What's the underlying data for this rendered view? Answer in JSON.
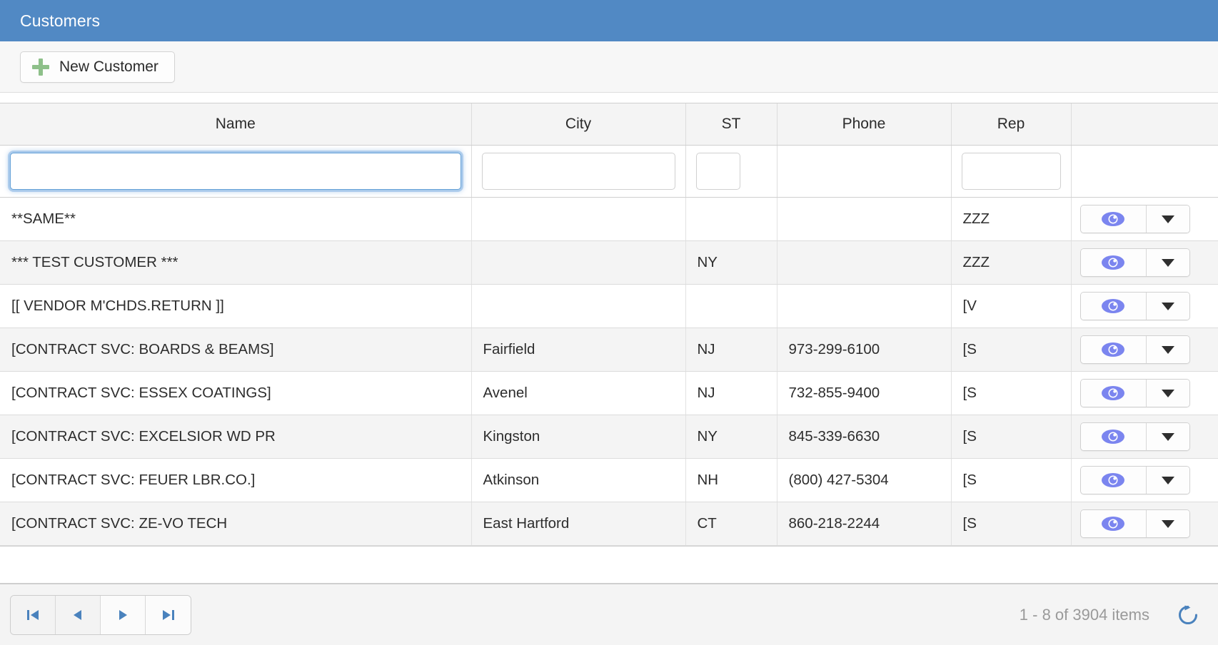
{
  "window": {
    "title": "Customers",
    "header_color": "#5189c4"
  },
  "toolbar": {
    "new_customer_label": "New Customer",
    "plus_icon_color": "#8ec08a"
  },
  "grid": {
    "columns": [
      {
        "key": "name",
        "label": "Name",
        "filterable": true,
        "filter_value": "",
        "focused": true
      },
      {
        "key": "city",
        "label": "City",
        "filterable": true,
        "filter_value": "",
        "focused": false
      },
      {
        "key": "st",
        "label": "ST",
        "filterable": true,
        "filter_value": "",
        "focused": false
      },
      {
        "key": "phone",
        "label": "Phone",
        "filterable": false,
        "filter_value": "",
        "focused": false
      },
      {
        "key": "rep",
        "label": "Rep",
        "filterable": true,
        "filter_value": "",
        "focused": false
      },
      {
        "key": "actions",
        "label": "",
        "filterable": false,
        "filter_value": "",
        "focused": false
      }
    ],
    "rows": [
      {
        "name": "**SAME**",
        "city": "",
        "st": "",
        "phone": "",
        "rep": "ZZZ"
      },
      {
        "name": "*** TEST CUSTOMER ***",
        "city": "",
        "st": "NY",
        "phone": "",
        "rep": "ZZZ"
      },
      {
        "name": "[[ VENDOR M'CHDS.RETURN ]]",
        "city": "",
        "st": "",
        "phone": "",
        "rep": "[V"
      },
      {
        "name": "[CONTRACT SVC: BOARDS & BEAMS]",
        "city": "Fairfield",
        "st": "NJ",
        "phone": "973-299-6100",
        "rep": "[S"
      },
      {
        "name": "[CONTRACT SVC: ESSEX COATINGS]",
        "city": "Avenel",
        "st": "NJ",
        "phone": "732-855-9400",
        "rep": "[S"
      },
      {
        "name": "[CONTRACT SVC: EXCELSIOR WD PR",
        "city": "Kingston",
        "st": "NY",
        "phone": "845-339-6630",
        "rep": "[S"
      },
      {
        "name": "[CONTRACT SVC: FEUER LBR.CO.]",
        "city": "Atkinson",
        "st": "NH",
        "phone": "(800) 427-5304",
        "rep": "[S"
      },
      {
        "name": "[CONTRACT SVC: ZE-VO TECH",
        "city": "East Hartford",
        "st": "CT",
        "phone": "860-218-2244",
        "rep": "[S"
      }
    ],
    "row_action": {
      "view_icon": "eye-icon",
      "view_icon_color": "#7b85ef",
      "caret_icon": "chevron-down-icon"
    }
  },
  "pager": {
    "first_label": "first-page",
    "prev_label": "previous-page",
    "next_label": "next-page",
    "last_label": "last-page",
    "arrow_color": "#4a82bd",
    "info": "1 - 8 of 3904 items",
    "refresh_label": "refresh",
    "refresh_color": "#4a82bd"
  }
}
